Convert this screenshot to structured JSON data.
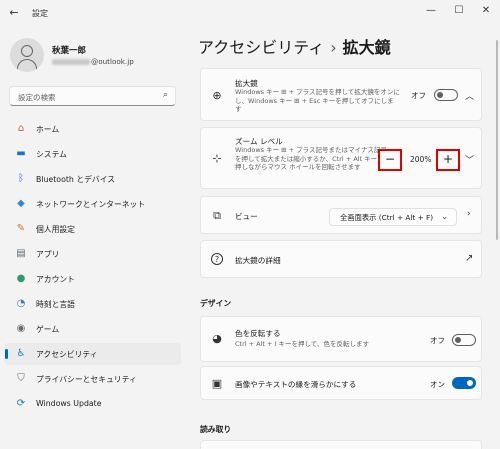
{
  "window": {
    "title": "設定",
    "back": "←",
    "min": "—",
    "max": "☐",
    "close": "✕"
  },
  "user": {
    "name": "秋葉一郎",
    "email_suffix": "@outlook.jp"
  },
  "search": {
    "placeholder": "設定の検索",
    "icon": "⌕"
  },
  "sidebar": {
    "items": [
      {
        "label": "ホーム",
        "icon": "home-icon",
        "glyph": "⌂",
        "color": "#c4622d"
      },
      {
        "label": "システム",
        "icon": "monitor-icon",
        "glyph": "▬",
        "color": "#1c74cc"
      },
      {
        "label": "Bluetooth とデバイス",
        "icon": "bluetooth-icon",
        "glyph": "ᛒ",
        "color": "#1c74cc"
      },
      {
        "label": "ネットワークとインターネット",
        "icon": "wifi-icon",
        "glyph": "◆",
        "color": "#2e8bd8"
      },
      {
        "label": "個人用設定",
        "icon": "pen-icon",
        "glyph": "✎",
        "color": "#c4762d"
      },
      {
        "label": "アプリ",
        "icon": "apps-icon",
        "glyph": "▤",
        "color": "#5a6b7b"
      },
      {
        "label": "アカウント",
        "icon": "account-icon",
        "glyph": "●",
        "color": "#2f9a6e"
      },
      {
        "label": "時刻と言語",
        "icon": "globe-clock-icon",
        "glyph": "◔",
        "color": "#2e7bc8"
      },
      {
        "label": "ゲーム",
        "icon": "gamepad-icon",
        "glyph": "◉",
        "color": "#6a6a6a"
      },
      {
        "label": "アクセシビリティ",
        "icon": "accessibility-icon",
        "glyph": "♿",
        "color": "#1c74cc"
      },
      {
        "label": "プライバシーとセキュリティ",
        "icon": "shield-icon",
        "glyph": "⛉",
        "color": "#6a6a6a"
      },
      {
        "label": "Windows Update",
        "icon": "update-icon",
        "glyph": "⟳",
        "color": "#1c74cc"
      }
    ],
    "selected": "アクセシビリティ"
  },
  "breadcrumb": {
    "parent": "アクセシビリティ",
    "separator": "›",
    "current": "拡大鏡"
  },
  "cards": {
    "magnifier": {
      "title": "拡大鏡",
      "desc": "Windows キー ⊞ + プラス記号を押して拡大鏡をオンにし、Windows キー ⊞ + Esc キーを押してオフにします",
      "state": "オフ",
      "on": false,
      "icon": "magnifier-icon",
      "glyph": "⊕"
    },
    "zoom": {
      "title": "ズーム レベル",
      "desc": "Windows キー ⊞ + プラス記号またはマイナス記号を押して拡大または縮小するか、Ctrl + Alt キーを押しながらマウス ホイールを回転させます",
      "value": "200%",
      "minus": "−",
      "plus": "+",
      "icon": "zoom-level-icon",
      "glyph": "⊹"
    },
    "view": {
      "title": "ビュー",
      "selected": "全画面表示 (Ctrl + Alt + F)",
      "icon": "view-icon",
      "glyph": "⧉"
    },
    "details": {
      "title": "拡大鏡の詳細",
      "icon": "help-icon",
      "glyph": "?"
    }
  },
  "design": {
    "heading": "デザイン",
    "invert": {
      "title": "色を反転する",
      "desc": "Ctrl + Alt + I キーを押して、色を反転します",
      "state": "オフ",
      "on": false,
      "icon": "palette-icon",
      "glyph": "◕"
    },
    "smooth": {
      "title": "画像やテキストの縁を滑らかにする",
      "state": "オン",
      "on": true,
      "icon": "image-icon",
      "glyph": "▣"
    }
  },
  "reading": {
    "heading": "読み取り"
  }
}
